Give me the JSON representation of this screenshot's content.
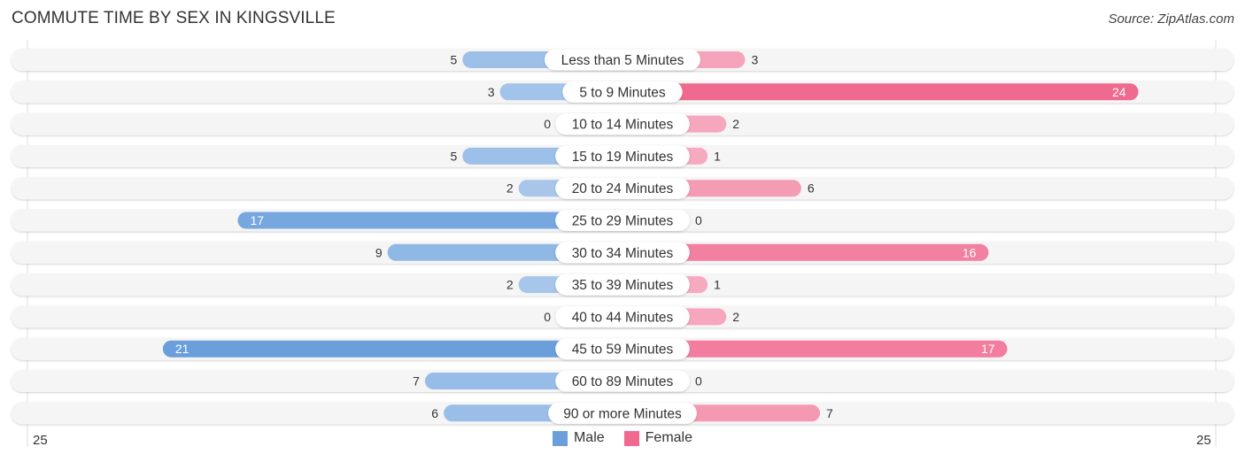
{
  "title": "COMMUTE TIME BY SEX IN KINGSVILLE",
  "source": "Source: ZipAtlas.com",
  "chart_data": {
    "type": "bar",
    "orientation": "horizontal-diverging",
    "title": "COMMUTE TIME BY SEX IN KINGSVILLE",
    "categories": [
      "Less than 5 Minutes",
      "5 to 9 Minutes",
      "10 to 14 Minutes",
      "15 to 19 Minutes",
      "20 to 24 Minutes",
      "25 to 29 Minutes",
      "30 to 34 Minutes",
      "35 to 39 Minutes",
      "40 to 44 Minutes",
      "45 to 59 Minutes",
      "60 to 89 Minutes",
      "90 or more Minutes"
    ],
    "series": [
      {
        "name": "Male",
        "color": "#6a9fdc",
        "values": [
          5,
          3,
          0,
          5,
          2,
          17,
          9,
          2,
          0,
          21,
          7,
          6
        ]
      },
      {
        "name": "Female",
        "color": "#f0698f",
        "values": [
          3,
          24,
          2,
          1,
          6,
          0,
          16,
          1,
          2,
          17,
          0,
          7
        ]
      }
    ],
    "axis_min_label": "25",
    "axis_max_label": "25",
    "xlim": [
      -25,
      25
    ],
    "legend_position": "bottom-center",
    "grid": false
  },
  "legend": [
    {
      "label": "Male",
      "color": "#6a9fdc"
    },
    {
      "label": "Female",
      "color": "#f0698f"
    }
  ],
  "axis": {
    "left_label": "25",
    "right_label": "25"
  }
}
